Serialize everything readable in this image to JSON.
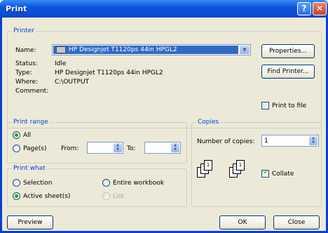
{
  "window": {
    "title": "Print",
    "help_glyph": "?",
    "close_glyph": "✕"
  },
  "printer": {
    "group_label": "Printer",
    "name_label": "Name:",
    "name_value": "HP Designjet T1120ps 44in HPGL2",
    "status_label": "Status:",
    "status_value": "Idle",
    "type_label": "Type:",
    "type_value": "HP Designjet T1120ps 44in HPGL2",
    "where_label": "Where:",
    "where_value": "C:\\OUTPUT",
    "comment_label": "Comment:",
    "properties_label": "Properties...",
    "find_printer_label": "Find Printer...",
    "print_to_file_label": "Print to file"
  },
  "print_range": {
    "group_label": "Print range",
    "all_label": "All",
    "pages_label": "Page(s)",
    "from_label": "From:",
    "to_label": "To:"
  },
  "copies": {
    "group_label": "Copies",
    "number_label": "Number of copies:",
    "number_value": "1",
    "collate_label": "Collate"
  },
  "print_what": {
    "group_label": "Print what",
    "selection_label": "Selection",
    "entire_workbook_label": "Entire workbook",
    "active_sheets_label": "Active sheet(s)",
    "list_label": "List"
  },
  "footer": {
    "preview_label": "Preview",
    "ok_label": "OK",
    "close_label": "Close"
  }
}
